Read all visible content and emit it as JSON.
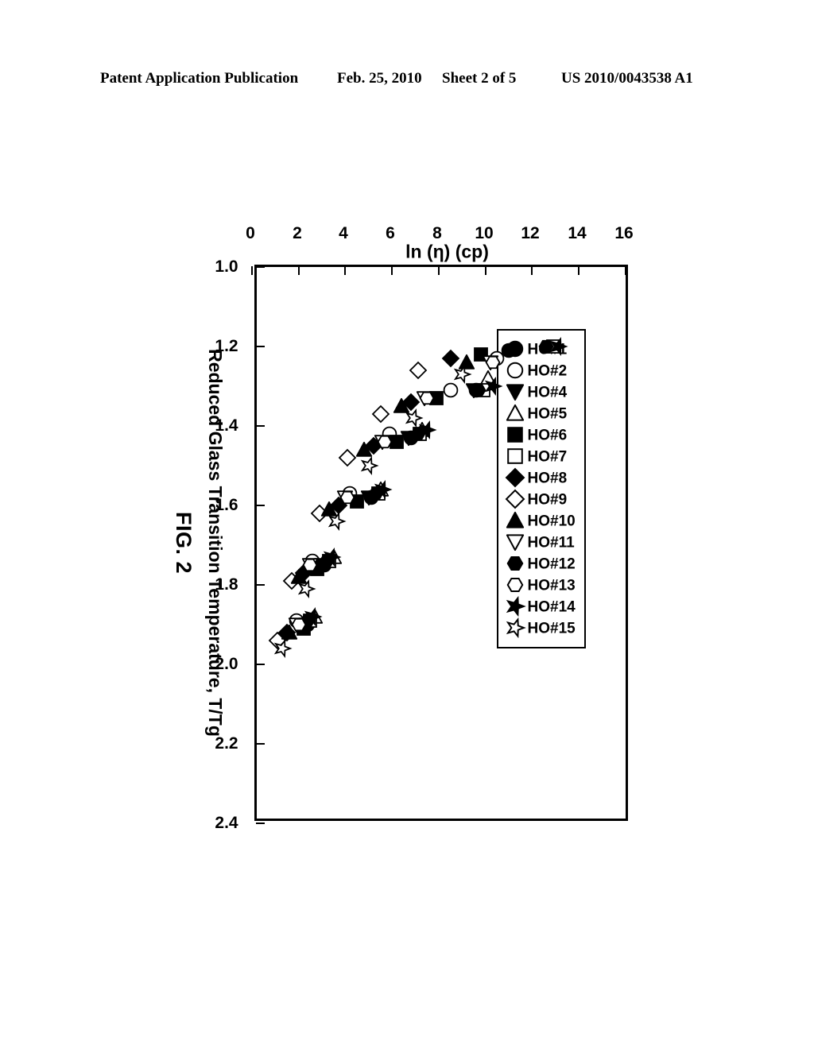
{
  "header": {
    "publication": "Patent Application Publication",
    "date": "Feb. 25, 2010",
    "sheet": "Sheet 2 of 5",
    "number": "US 2010/0043538 A1"
  },
  "figure": {
    "caption": "FIG. 2"
  },
  "chart_data": {
    "type": "scatter",
    "title": "",
    "xlabel": "Reduced Glass Transition Temperature, T/Tg",
    "ylabel": "ln (η) (cp)",
    "xlim": [
      1.0,
      2.4
    ],
    "ylim": [
      0,
      16
    ],
    "xticks": [
      "1.0",
      "1.2",
      "1.4",
      "1.6",
      "1.8",
      "2.0",
      "2.2",
      "2.4"
    ],
    "yticks": [
      "0",
      "2",
      "4",
      "6",
      "8",
      "10",
      "12",
      "14",
      "16"
    ],
    "xtick_values": [
      1.0,
      1.2,
      1.4,
      1.6,
      1.8,
      2.0,
      2.2,
      2.4
    ],
    "ytick_values": [
      0,
      2,
      4,
      6,
      8,
      10,
      12,
      14,
      16
    ],
    "grid": false,
    "legend_position": "upper-left",
    "rotation_note": "figure drawn in landscape, rotated 90 degrees on the page",
    "series": [
      {
        "name": "HO#1",
        "marker": "filled-circle",
        "x": [
          1.21,
          1.31,
          1.43,
          1.58,
          1.75,
          1.9
        ],
        "y": [
          11.0,
          9.6,
          6.8,
          5.1,
          3.1,
          2.4
        ]
      },
      {
        "name": "HO#2",
        "marker": "open-circle",
        "x": [
          1.23,
          1.31,
          1.42,
          1.57,
          1.74,
          1.89
        ],
        "y": [
          10.5,
          8.5,
          5.9,
          4.2,
          2.6,
          1.9
        ]
      },
      {
        "name": "HO#4",
        "marker": "filled-right-triangle",
        "x": [
          1.31,
          1.43,
          1.58,
          1.75,
          1.9
        ],
        "y": [
          9.5,
          6.7,
          5.0,
          3.0,
          2.3
        ]
      },
      {
        "name": "HO#5",
        "marker": "open-left-triangle",
        "x": [
          1.28,
          1.41,
          1.56,
          1.73,
          1.88
        ],
        "y": [
          10.1,
          7.3,
          5.5,
          3.5,
          2.7
        ]
      },
      {
        "name": "HO#6",
        "marker": "filled-square",
        "x": [
          1.22,
          1.33,
          1.44,
          1.59,
          1.76,
          1.91
        ],
        "y": [
          9.8,
          7.9,
          6.2,
          4.5,
          2.8,
          2.2
        ]
      },
      {
        "name": "HO#7",
        "marker": "open-square",
        "x": [
          1.2,
          1.31,
          1.42,
          1.57,
          1.74,
          1.89
        ],
        "y": [
          12.9,
          9.9,
          7.2,
          5.4,
          3.3,
          2.5
        ]
      },
      {
        "name": "HO#8",
        "marker": "filled-diamond",
        "x": [
          1.23,
          1.34,
          1.45,
          1.6,
          1.77,
          1.92
        ],
        "y": [
          8.5,
          6.8,
          5.2,
          3.7,
          2.2,
          1.5
        ]
      },
      {
        "name": "HO#9",
        "marker": "open-diamond",
        "x": [
          1.26,
          1.37,
          1.48,
          1.62,
          1.79,
          1.94
        ],
        "y": [
          7.1,
          5.5,
          4.1,
          2.9,
          1.7,
          1.1
        ]
      },
      {
        "name": "HO#10",
        "marker": "filled-left-triangle",
        "x": [
          1.24,
          1.35,
          1.46,
          1.61,
          1.78,
          1.92
        ],
        "y": [
          9.2,
          6.4,
          4.8,
          3.3,
          2.0,
          1.6
        ]
      },
      {
        "name": "HO#11",
        "marker": "open-right-triangle",
        "x": [
          1.24,
          1.33,
          1.44,
          1.58,
          1.75,
          1.9
        ],
        "y": [
          10.2,
          7.4,
          5.6,
          4.0,
          2.5,
          1.9
        ]
      },
      {
        "name": "HO#12",
        "marker": "filled-hexagon",
        "x": [
          1.2,
          1.31,
          1.42,
          1.57,
          1.74,
          1.89
        ],
        "y": [
          12.6,
          9.7,
          7.1,
          5.3,
          3.2,
          2.4
        ]
      },
      {
        "name": "HO#13",
        "marker": "open-hexagon",
        "x": [
          1.24,
          1.33,
          1.44,
          1.58,
          1.75,
          1.9
        ],
        "y": [
          10.3,
          7.5,
          5.7,
          4.1,
          2.5,
          2.0
        ]
      },
      {
        "name": "HO#14",
        "marker": "filled-star",
        "x": [
          1.2,
          1.3,
          1.41,
          1.56,
          1.73,
          1.88
        ],
        "y": [
          13.1,
          10.3,
          7.5,
          5.6,
          3.4,
          2.6
        ]
      },
      {
        "name": "HO#15",
        "marker": "open-star",
        "x": [
          1.27,
          1.38,
          1.5,
          1.64,
          1.81,
          1.96
        ],
        "y": [
          9.0,
          6.9,
          5.0,
          3.6,
          2.3,
          1.3
        ]
      }
    ]
  }
}
